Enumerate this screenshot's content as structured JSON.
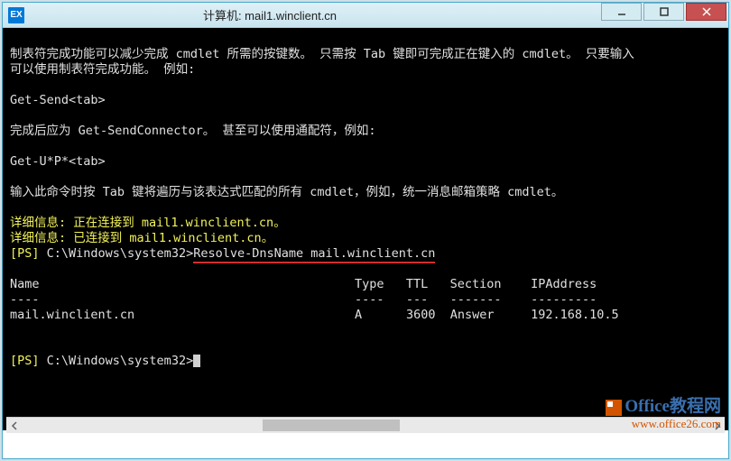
{
  "window": {
    "title": "计算机: mail1.winclient.cn",
    "icon_label": "EX"
  },
  "terminal": {
    "line1": "制表符完成功能可以减少完成 cmdlet 所需的按键数。 只需按 Tab 键即可完成正在键入的 cmdlet。 只要输入",
    "line2": "可以使用制表符完成功能。 例如:",
    "line_getsend": "Get-Send<tab>",
    "line_complete": "完成后应为 Get-SendConnector。 甚至可以使用通配符，例如:",
    "line_getu": "Get-U*P*<tab>",
    "line_tab_desc": "输入此命令时按 Tab 键将遍历与该表达式匹配的所有 cmdlet，例如，统一消息邮箱策略 cmdlet。",
    "detail1_prefix": "详细信息: 正在连接到 ",
    "detail1_host": "mail1.winclient.cn",
    "detail1_suffix": "。",
    "detail2_prefix": "详细信息: 已连接到 ",
    "detail2_host": "mail1.winclient.cn",
    "detail2_suffix": "。",
    "ps_label": "[PS]",
    "prompt_path": " C:\\Windows\\system32>",
    "command": "Resolve-DnsName mail.winclient.cn",
    "table": {
      "headers": {
        "name": "Name",
        "type": "Type",
        "ttl": "TTL",
        "section": "Section",
        "ip": "IPAddress"
      },
      "dividers": {
        "name": "----",
        "type": "----",
        "ttl": "---",
        "section": "-------",
        "ip": "---------"
      },
      "row": {
        "name": "mail.winclient.cn",
        "type": "A",
        "ttl": "3600",
        "section": "Answer",
        "ip": "192.168.10.5"
      }
    },
    "prompt2": " C:\\Windows\\system32>"
  },
  "watermark": {
    "brand_main": "Office",
    "brand_sub": "教程网",
    "url": "www.office26.com"
  },
  "chart_data": {
    "type": "table",
    "title": "Resolve-DnsName mail.winclient.cn",
    "columns": [
      "Name",
      "Type",
      "TTL",
      "Section",
      "IPAddress"
    ],
    "rows": [
      [
        "mail.winclient.cn",
        "A",
        3600,
        "Answer",
        "192.168.10.5"
      ]
    ]
  }
}
